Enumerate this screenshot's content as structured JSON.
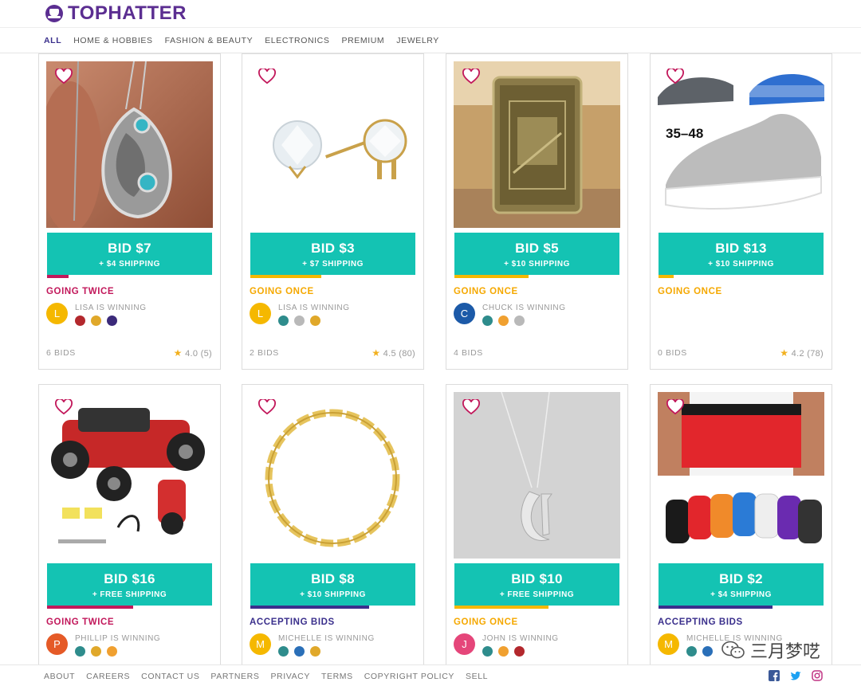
{
  "brand": {
    "top": "TOP",
    "hatter": "HATTER"
  },
  "nav": [
    "ALL",
    "HOME & HOBBIES",
    "FASHION & BEAUTY",
    "ELECTRONICS",
    "PREMIUM",
    "JEWELRY"
  ],
  "cards": [
    {
      "bid": "BID $7",
      "shipping": "+ $4 SHIPPING",
      "status": "GOING TWICE",
      "status_color": "#c2185b",
      "bar_color": "#c2185b",
      "bar_fraction": 0.13,
      "winner": "LISA IS WINNING",
      "avatar": "L",
      "avatar_color": "#f5b800",
      "badge_icons": [
        "red-badge-icon",
        "gold-badge-icon",
        "purple-badge-icon"
      ],
      "bids": "6 BIDS",
      "rating": "4.0",
      "reviews": "(5)"
    },
    {
      "bid": "BID $3",
      "shipping": "+ $7 SHIPPING",
      "status": "GOING ONCE",
      "status_color": "#f5a800",
      "bar_color": "#f5b800",
      "bar_fraction": 0.43,
      "winner": "LISA IS WINNING",
      "avatar": "L",
      "avatar_color": "#f5b800",
      "badge_icons": [
        "teal-badge-icon",
        "gray-badge-icon",
        "gold-badge-icon"
      ],
      "bids": "2 BIDS",
      "rating": "4.5",
      "reviews": "(80)"
    },
    {
      "bid": "BID $5",
      "shipping": "+ $10 SHIPPING",
      "status": "GOING ONCE",
      "status_color": "#f5a800",
      "bar_color": "#f5b800",
      "bar_fraction": 0.45,
      "winner": "CHUCK IS WINNING",
      "avatar": "C",
      "avatar_color": "#1c5aa8",
      "badge_icons": [
        "teal-badge-icon",
        "orange-badge-icon",
        "gray-badge-icon"
      ],
      "bids": "4 BIDS",
      "rating": "",
      "reviews": ""
    },
    {
      "bid": "BID $13",
      "shipping": "+ $10 SHIPPING",
      "status": "GOING ONCE",
      "status_color": "#f5a800",
      "bar_color": "#f5b800",
      "bar_fraction": 0.09,
      "winner": "",
      "avatar": "",
      "avatar_color": "",
      "badge_icons": [],
      "bids": "0 BIDS",
      "rating": "4.2",
      "reviews": "(78)"
    },
    {
      "bid": "BID $16",
      "shipping": "+ FREE SHIPPING",
      "status": "GOING TWICE",
      "status_color": "#c2185b",
      "bar_color": "#c2185b",
      "bar_fraction": 0.52,
      "winner": "PHILLIP IS WINNING",
      "avatar": "P",
      "avatar_color": "#e55a27",
      "badge_icons": [
        "teal-badge-icon",
        "gold-badge-icon",
        "orange-badge-icon"
      ],
      "bids": "",
      "rating": "",
      "reviews": ""
    },
    {
      "bid": "BID $8",
      "shipping": "+ $10 SHIPPING",
      "status": "ACCEPTING BIDS",
      "status_color": "#3a2f8c",
      "bar_color": "#3a2f8c",
      "bar_fraction": 0.72,
      "winner": "MICHELLE IS WINNING",
      "avatar": "M",
      "avatar_color": "#f5b800",
      "badge_icons": [
        "teal-badge-icon",
        "blue-badge-icon",
        "gold-badge-icon"
      ],
      "bids": "",
      "rating": "",
      "reviews": ""
    },
    {
      "bid": "BID $10",
      "shipping": "+ FREE SHIPPING",
      "status": "GOING ONCE",
      "status_color": "#f5a800",
      "bar_color": "#f5b800",
      "bar_fraction": 0.57,
      "winner": "JOHN IS WINNING",
      "avatar": "J",
      "avatar_color": "#e5467a",
      "badge_icons": [
        "teal-badge-icon",
        "orange-badge-icon",
        "red-badge-icon"
      ],
      "bids": "",
      "rating": "",
      "reviews": ""
    },
    {
      "bid": "BID $2",
      "shipping": "+ $4 SHIPPING",
      "status": "ACCEPTING BIDS",
      "status_color": "#3a2f8c",
      "bar_color": "#3a2f8c",
      "bar_fraction": 0.69,
      "winner": "MICHELLE IS WINNING",
      "avatar": "M",
      "avatar_color": "#f5b800",
      "badge_icons": [
        "teal-badge-icon",
        "blue-badge-icon"
      ],
      "bids": "",
      "rating": "",
      "reviews": ""
    }
  ],
  "footer": [
    "ABOUT",
    "CAREERS",
    "CONTACT US",
    "PARTNERS",
    "PRIVACY",
    "TERMS",
    "COPYRIGHT POLICY",
    "SELL"
  ],
  "social_icons": [
    "facebook-icon",
    "twitter-icon",
    "instagram-icon"
  ],
  "watermark": "三月梦呓",
  "colors": {
    "accent_teal": "#14c3b3",
    "brand_purple": "#5b2e91",
    "heart": "#c2185b"
  }
}
